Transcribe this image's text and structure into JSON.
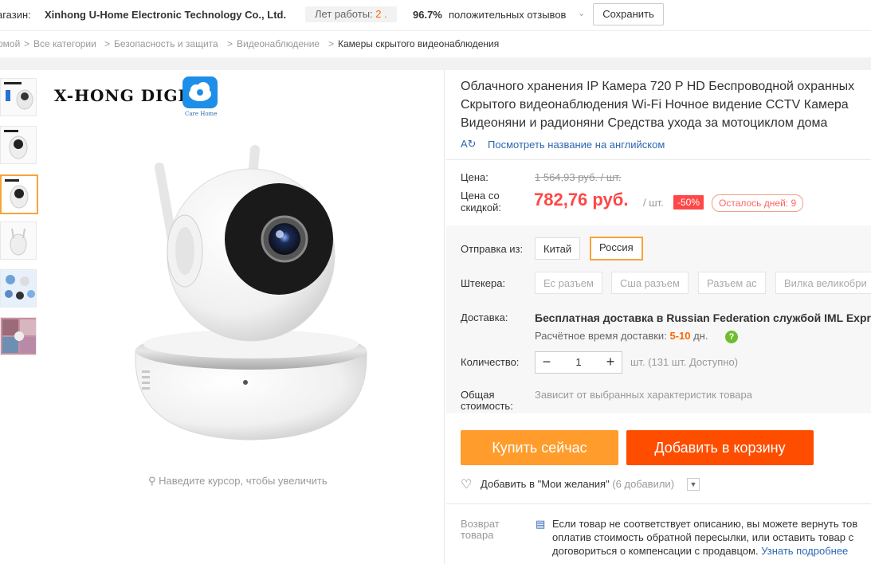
{
  "store": {
    "label": "агазин:",
    "name": "Xinhong U-Home Electronic Technology Co., Ltd.",
    "years_label": "Лет работы:",
    "years_value": "2 .",
    "rating_pct": "96.7%",
    "rating_text": "положительных отзывов",
    "save_label": "Сохранить"
  },
  "breadcrumb": {
    "items": [
      "омой",
      "Все категории",
      "Безопасность и защита",
      "Видеонаблюдение",
      "Камеры скрытого видеонаблюдения"
    ],
    "separator": ">"
  },
  "gallery": {
    "brand_text": "X-HONG DIGIT",
    "app_caption": "Care Home",
    "zoom_hint": "Наведите курсор, чтобы увеличить",
    "thumbs_count": 6,
    "active_thumb": 3
  },
  "product": {
    "title_lines": [
      "Облачного хранения IP Камера 720 P HD Беспроводной охранных",
      "Скрытого видеонаблюдения Wi-Fi Ночное видение CCTV Камера",
      "Видеоняни и радионяни Средства ухода за мотоциклом дома"
    ],
    "translate_link": "Посмотреть название на английском"
  },
  "price": {
    "label": "Цена:",
    "old": "1 564,93 руб. / шт.",
    "discount_label_1": "Цена со",
    "discount_label_2": "скидкой:",
    "new": "782,76 руб.",
    "per_unit": "/ шт.",
    "discount_badge": "-50%",
    "days_left": "Осталось дней: 9"
  },
  "options": {
    "ship_from_label": "Отправка из:",
    "ship_from": [
      "Китай",
      "Россия"
    ],
    "ship_from_selected": "Россия",
    "plugs_label": "Штекера:",
    "plugs": [
      "Ес разъем",
      "Сша разъем",
      "Разъем ас",
      "Вилка великобри"
    ]
  },
  "delivery": {
    "label": "Доставка:",
    "main_prefix": "Бесплатная доставка в",
    "main_country": "Russian Federation",
    "main_suffix": "службой IML Expre",
    "time_prefix": "Расчётное время доставки:",
    "time_days": "5-10",
    "time_suffix": "дн."
  },
  "quantity": {
    "label": "Количество:",
    "value": "1",
    "available": "шт. (131 шт. Доступно)"
  },
  "total": {
    "label_1": "Общая",
    "label_2": "стоимость:",
    "note": "Зависит от выбранных характеристик товара"
  },
  "actions": {
    "buy_now": "Купить сейчас",
    "add_to_cart": "Добавить в корзину",
    "wishlist": "Добавить в \"Мои желания\"",
    "wishlist_count": "(6 добавили)"
  },
  "returns": {
    "label": "Возврат товара",
    "lines": [
      "Если товар не соответствует описанию, вы можете вернуть тов",
      "оплатив стоимость обратной пересылки, или оставить товар с",
      "договориться о компенсации с продавцом."
    ],
    "learn_more": "Узнать подробнее"
  },
  "colors": {
    "accent_orange": "#ff9c2b",
    "cart_red": "#ff4d00",
    "price_red": "#ff4747",
    "link_blue": "#2f67b2",
    "selected_border": "#f8a33b"
  }
}
